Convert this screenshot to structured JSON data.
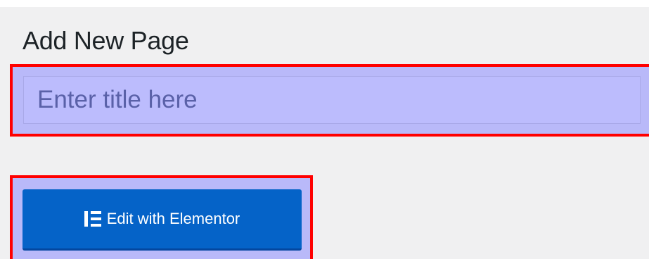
{
  "page": {
    "title": "Add New Page"
  },
  "title_input": {
    "placeholder": "Enter title here",
    "value": ""
  },
  "elementor_button": {
    "label": "Edit with Elementor",
    "icon": "elementor-icon"
  },
  "colors": {
    "background": "#f0f0f1",
    "highlight_border": "#ff0000",
    "highlight_fill": "#8c8cff",
    "button_blue": "#0563c8",
    "title_text": "#1d2327"
  }
}
